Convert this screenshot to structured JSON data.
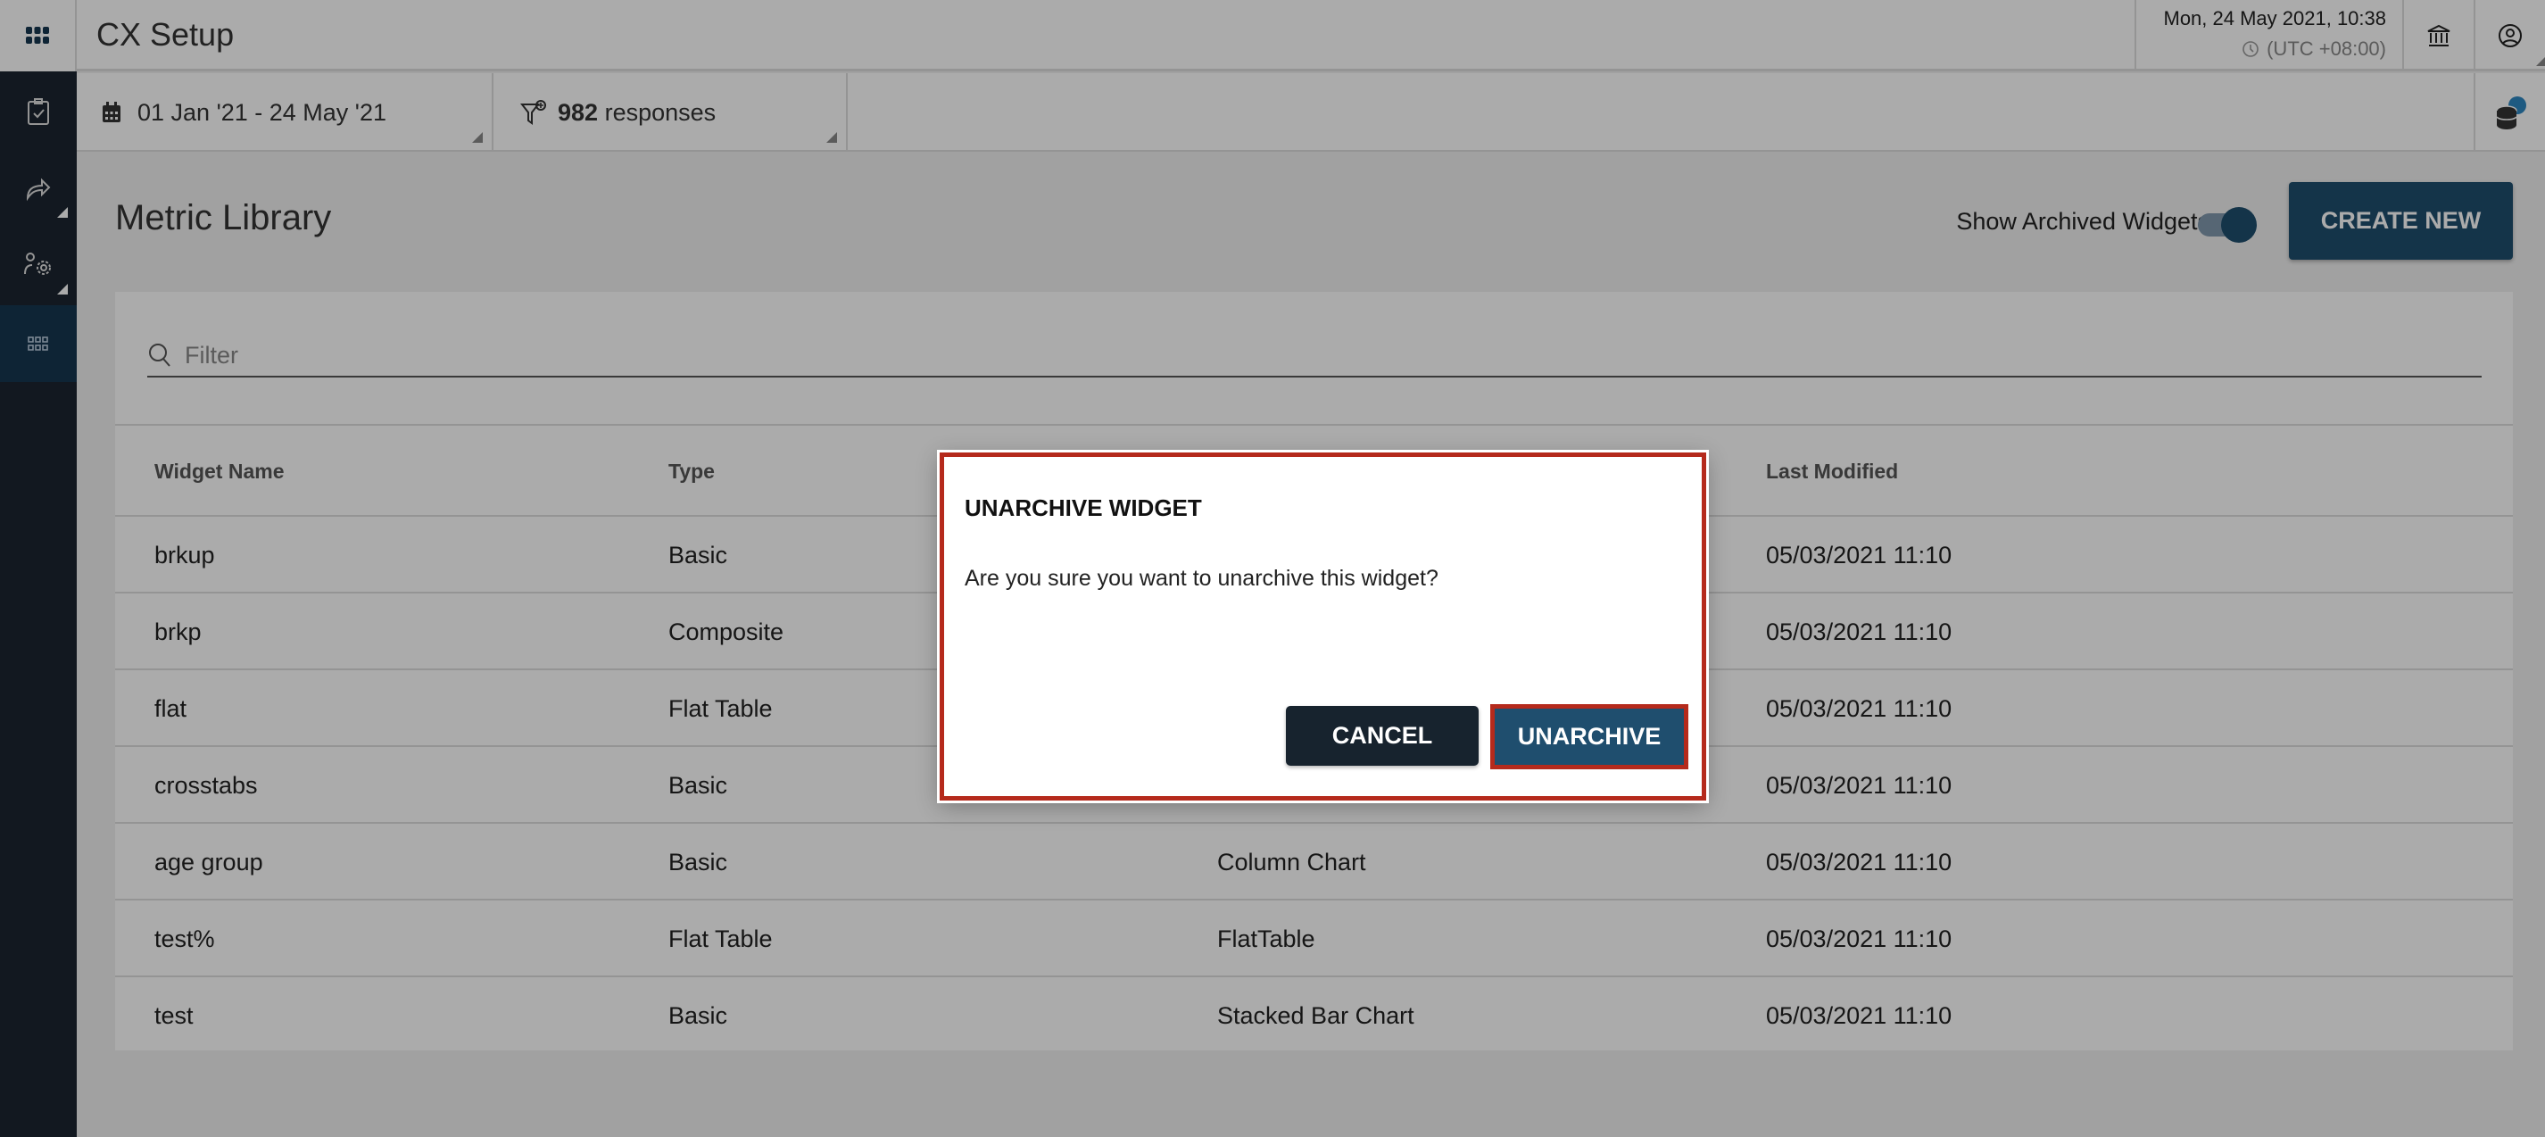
{
  "header": {
    "app_title": "CX Setup",
    "datetime": "Mon, 24 May 2021, 10:38",
    "timezone": "(UTC +08:00)"
  },
  "filters": {
    "date_range": "01 Jan '21 - 24 May '21",
    "responses_count": "982",
    "responses_label": "responses"
  },
  "sidebar": {
    "items": [
      {
        "icon": "clipboard-check-icon"
      },
      {
        "icon": "share-forward-icon"
      },
      {
        "icon": "users-settings-icon"
      },
      {
        "icon": "widgets-grid-icon",
        "active": true
      }
    ]
  },
  "main": {
    "title": "Metric Library",
    "show_archived_label": "Show Archived Widgets",
    "show_archived_on": true,
    "create_new_label": "CREATE NEW",
    "filter_placeholder": "Filter"
  },
  "table": {
    "columns": [
      "Widget Name",
      "Type",
      "",
      "Last Modified"
    ],
    "rows": [
      [
        "brkup",
        "Basic",
        "",
        "05/03/2021 11:10"
      ],
      [
        "brkp",
        "Composite",
        "",
        "05/03/2021 11:10"
      ],
      [
        "flat",
        "Flat Table",
        "",
        "05/03/2021 11:10"
      ],
      [
        "crosstabs",
        "Basic",
        "",
        "05/03/2021 11:10"
      ],
      [
        "age group",
        "Basic",
        "Column Chart",
        "05/03/2021 11:10"
      ],
      [
        "test%",
        "Flat Table",
        "FlatTable",
        "05/03/2021 11:10"
      ],
      [
        "test",
        "Basic",
        "Stacked Bar Chart",
        "05/03/2021 11:10"
      ]
    ]
  },
  "dialog": {
    "title": "UNARCHIVE WIDGET",
    "message": "Are you sure you want to unarchive this widget?",
    "cancel_label": "CANCEL",
    "confirm_label": "UNARCHIVE"
  },
  "colors": {
    "primary": "#163650",
    "sidebar": "#1b2430",
    "highlight": "#b52a1c",
    "confirm": "#1f4e6e"
  }
}
